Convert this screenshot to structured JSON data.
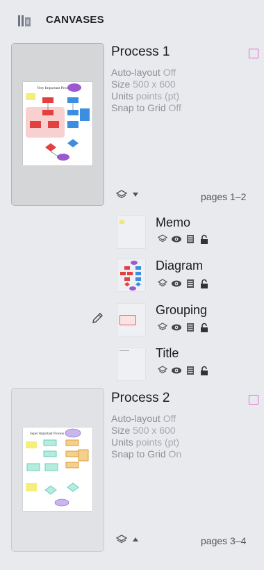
{
  "header": {
    "title": "CANVASES",
    "icon": "canvases-icon"
  },
  "canvases": [
    {
      "title": "Process 1",
      "info": [
        {
          "key": "Auto-layout",
          "value": "Off"
        },
        {
          "key": "Size",
          "value": "500 x 600"
        },
        {
          "key": "Units",
          "value": "points (pt)"
        },
        {
          "key": "Snap to Grid",
          "value": "Off"
        }
      ],
      "pages": "pages 1–2",
      "thumbnail_title": "Very Important Process"
    },
    {
      "title": "Process 2",
      "info": [
        {
          "key": "Auto-layout",
          "value": "Off"
        },
        {
          "key": "Size",
          "value": "500 x 600"
        },
        {
          "key": "Units",
          "value": "points (pt)"
        },
        {
          "key": "Snap to Grid",
          "value": "On"
        }
      ],
      "pages": "pages 3–4",
      "thumbnail_title": "Super Important Process"
    }
  ],
  "layers": [
    {
      "name": "Memo"
    },
    {
      "name": "Diagram"
    },
    {
      "name": "Grouping"
    },
    {
      "name": "Title"
    }
  ],
  "colors": {
    "accent": "#e36bd6",
    "background": "#e8eaee"
  }
}
